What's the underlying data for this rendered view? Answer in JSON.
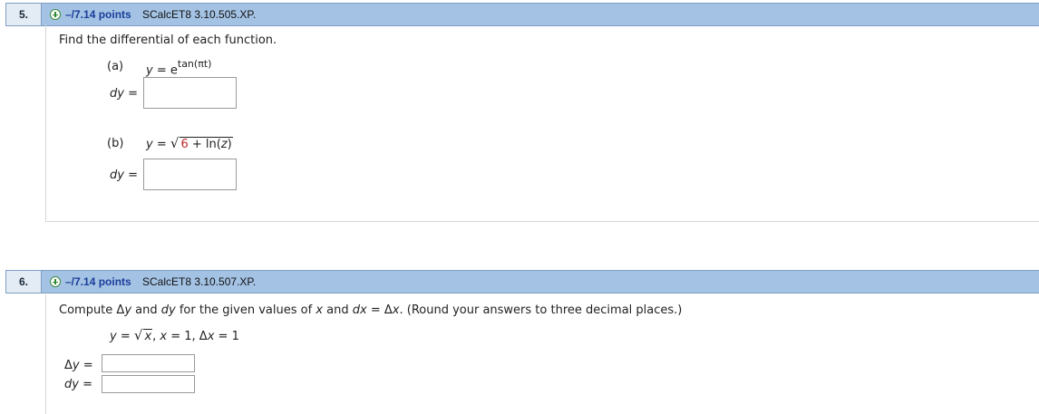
{
  "q5": {
    "number": "5.",
    "points": "–/7.14 points",
    "source": "SCalcET8 3.10.505.XP.",
    "instruction": "Find the differential of each function.",
    "part_a": {
      "label": "(a)",
      "lhs": "y",
      "eq": " = ",
      "base": "e",
      "exponent": "tan(πt)",
      "answer_label": "dy",
      "answer_eq": " =",
      "answer_value": ""
    },
    "part_b": {
      "label": "(b)",
      "lhs": "y",
      "eq": " = ",
      "radicand_num": "6",
      "radicand_rest": " + ln(",
      "radicand_var": "z",
      "radicand_close": ")",
      "answer_label": "dy",
      "answer_eq": " =",
      "answer_value": ""
    }
  },
  "q6": {
    "number": "6.",
    "points": "–/7.14 points",
    "source": "SCalcET8 3.10.507.XP.",
    "instruction": {
      "p1": "Compute Δ",
      "y1": "y",
      "p2": " and ",
      "dy": "dy",
      "p3": " for the given values of ",
      "x": "x",
      "p4": " and ",
      "dx": "dx",
      "p5": " = Δ",
      "x2": "x",
      "p6": ". (Round your answers to three decimal places.)"
    },
    "given": {
      "lhs": "y",
      "eq": " = ",
      "radicand": "x",
      "rest1": ",   ",
      "xvar": "x",
      "rest2": " = 1,   Δ",
      "dxvar": "x",
      "rest3": " = 1"
    },
    "answers": {
      "delta_y_label_prefix": "Δ",
      "delta_y_label_var": "y",
      "delta_y_eq": " =",
      "delta_y_value": "",
      "dy_label": "dy",
      "dy_eq": " =",
      "dy_value": ""
    }
  }
}
